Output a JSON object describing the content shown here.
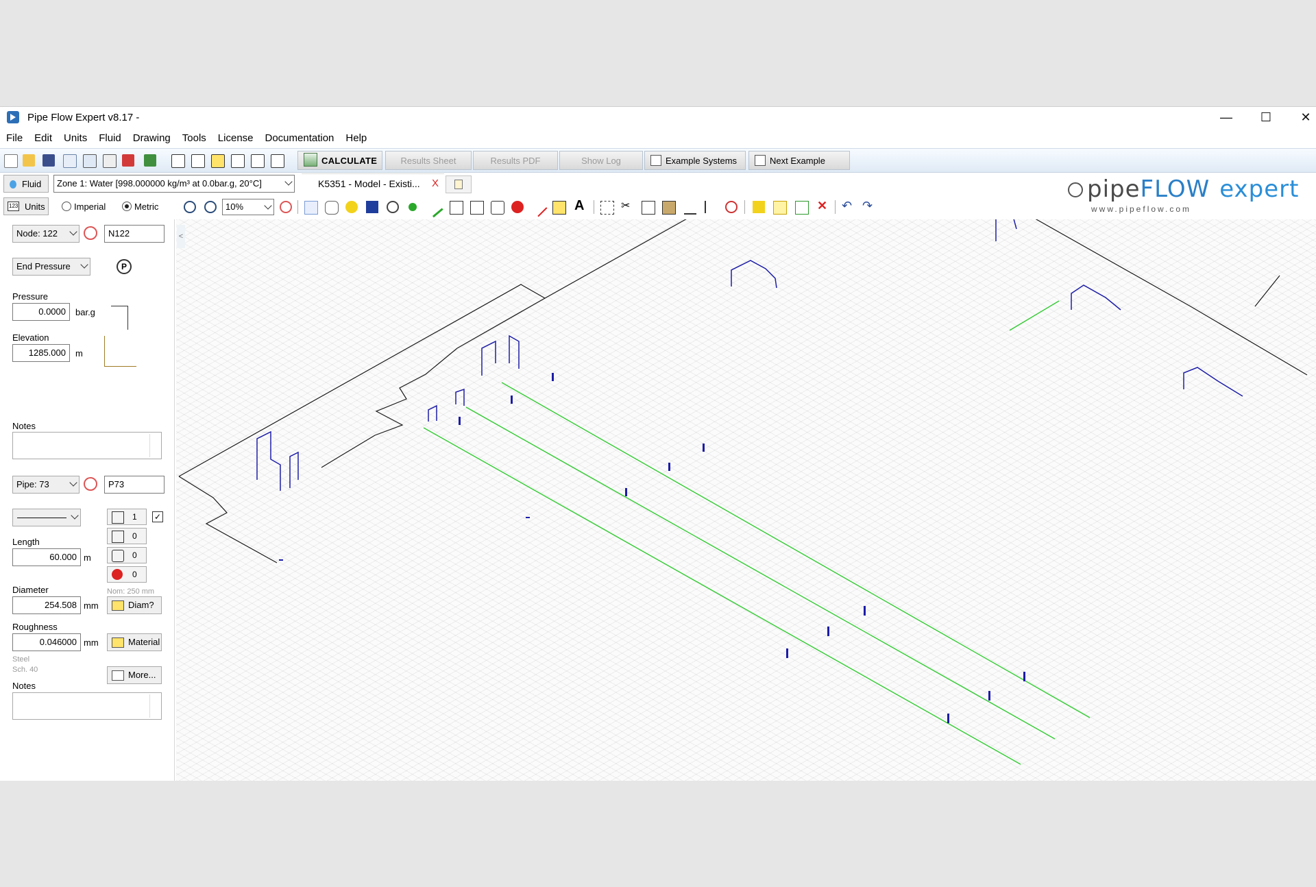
{
  "window": {
    "title": "Pipe Flow Expert v8.17 -"
  },
  "menu": [
    "File",
    "Edit",
    "Units",
    "Fluid",
    "Drawing",
    "Tools",
    "License",
    "Documentation",
    "Help"
  ],
  "toolbar": {
    "calculate": "CALCULATE",
    "results_sheet": "Results Sheet",
    "results_pdf": "Results PDF",
    "show_log": "Show Log",
    "example_systems": "Example Systems",
    "next_example": "Next Example"
  },
  "fluid": {
    "button": "Fluid",
    "zone": "Zone 1: Water [998.000000 kg/m³ at 0.0bar.g, 20°C]"
  },
  "tab": {
    "label": "K5351 - Model - Existi...",
    "close": "X"
  },
  "logo": {
    "name_pipe": "pipe",
    "name_flow": "FLOW",
    "name_expert": "expert",
    "url": "www.pipeflow.com"
  },
  "units": {
    "button": "Units",
    "imperial": "Imperial",
    "metric": "Metric",
    "selected": "Metric"
  },
  "zoom": {
    "value": "10%"
  },
  "node": {
    "selector": "Node: 122",
    "name": "N122",
    "type": "End Pressure",
    "pressure_label": "Pressure",
    "pressure": "0.0000",
    "pressure_unit": "bar.g",
    "elevation_label": "Elevation",
    "elevation": "1285.000",
    "elevation_unit": "m",
    "notes_label": "Notes"
  },
  "pipe": {
    "selector": "Pipe: 73",
    "name": "P73",
    "fittings_count": "1",
    "component_count_1": "0",
    "component_count_2": "0",
    "pump_count": "0",
    "length_label": "Length",
    "length": "60.000",
    "length_unit": "m",
    "diameter_label": "Diameter",
    "diameter_nominal": "Nom: 250 mm",
    "diameter": "254.508",
    "diameter_unit": "mm",
    "diam_button": "Diam?",
    "roughness_label": "Roughness",
    "roughness": "0.046000",
    "roughness_unit": "mm",
    "material_button": "Material",
    "material_name": "Steel",
    "material_schedule": "Sch. 40",
    "more_button": "More...",
    "notes_label": "Notes"
  },
  "colors": {
    "pipe": "#1a1a1a",
    "selected_pipe": "#33cc33",
    "node_marker": "#1c1ca8",
    "accent": "#2a7fc7"
  },
  "icons": [
    "new-icon",
    "open-icon",
    "save-icon",
    "email-icon",
    "print-preview-icon",
    "print-icon",
    "pdf-icon",
    "image-icon",
    "iso-icon",
    "edit-icon",
    "pipe-data-icon",
    "label-icon",
    "numbers-icon",
    "calc-icon",
    "zoom-out-icon",
    "zoom-in-icon",
    "zoom-fit-icon",
    "select-icon",
    "pan-icon",
    "move-icon",
    "tank-icon",
    "pressure-icon",
    "node-icon",
    "pipe-icon",
    "fitting-icon",
    "component-icon",
    "control-valve-icon",
    "pump-icon",
    "line-icon",
    "valve-icon",
    "text-icon",
    "select-area-icon",
    "cut-icon",
    "copy-icon",
    "paste-icon",
    "flip-h-icon",
    "flip-v-icon",
    "find-icon",
    "import-icon",
    "align-icon",
    "distribute-icon",
    "delete-icon",
    "undo-icon",
    "redo-icon"
  ]
}
